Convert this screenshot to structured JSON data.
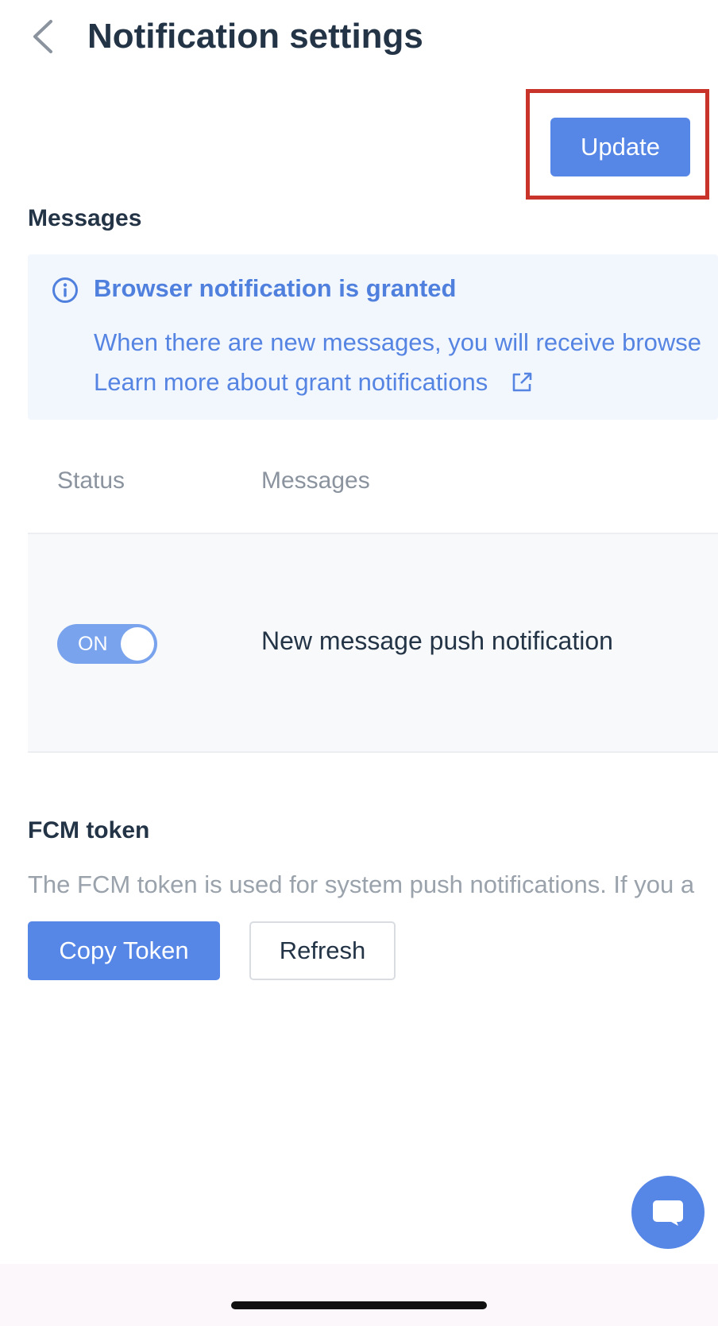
{
  "header": {
    "title": "Notification settings",
    "back_icon": "chevron-left-icon"
  },
  "actions": {
    "update_label": "Update"
  },
  "messages_section": {
    "title": "Messages",
    "alert": {
      "icon": "info-icon",
      "title": "Browser notification is granted",
      "text": "When there are new messages, you will receive browse",
      "link_label": "Learn more about grant notifications",
      "link_icon": "external-link-icon"
    },
    "table": {
      "columns": [
        "Status",
        "Messages"
      ],
      "rows": [
        {
          "status": "ON",
          "enabled": true,
          "message": "New message push notification"
        }
      ]
    }
  },
  "fcm_section": {
    "title": "FCM token",
    "description": "The FCM token is used for system push notifications. If you a",
    "copy_label": "Copy Token",
    "refresh_label": "Refresh"
  },
  "fab": {
    "icon": "chat-icon"
  },
  "colors": {
    "primary": "#5686e6",
    "highlight": "#c9342a",
    "alert_bg": "#f2f7fd",
    "alert_text": "#5584e2",
    "toggle_on": "#7aa3ee"
  }
}
